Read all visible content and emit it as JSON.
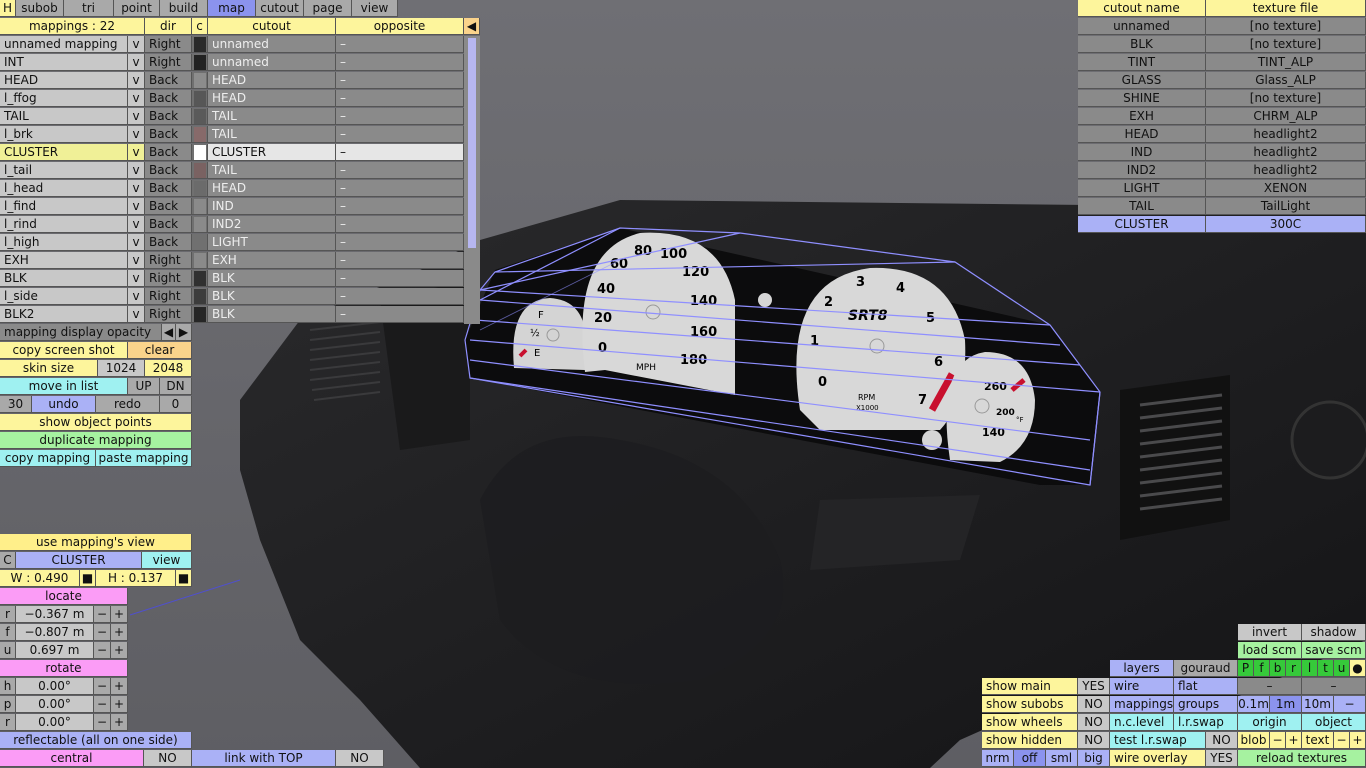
{
  "menu": {
    "h": "H",
    "items": [
      "subob",
      "tri",
      "point",
      "build",
      "map",
      "cutout",
      "page",
      "view"
    ],
    "active": "map"
  },
  "mappings": {
    "header": {
      "count": "mappings : 22",
      "dir": "dir",
      "c": "c",
      "cutout": "cutout",
      "opposite": "opposite",
      "arrow": "◀"
    },
    "rows": [
      {
        "name": "unnamed mapping",
        "v": "v",
        "dir": "Right",
        "swatch": "#2a2a2a",
        "cutout": "unnamed",
        "opposite": "–"
      },
      {
        "name": "INT",
        "v": "v",
        "dir": "Right",
        "swatch": "#222222",
        "cutout": "unnamed",
        "opposite": "–"
      },
      {
        "name": "HEAD",
        "v": "v",
        "dir": "Back",
        "swatch": "#8c8c8c",
        "cutout": "HEAD",
        "opposite": "–"
      },
      {
        "name": "l_ffog",
        "v": "v",
        "dir": "Back",
        "swatch": "#575757",
        "cutout": "HEAD",
        "opposite": "–"
      },
      {
        "name": "TAIL",
        "v": "v",
        "dir": "Back",
        "swatch": "#5a5a5a",
        "cutout": "TAIL",
        "opposite": "–"
      },
      {
        "name": "l_brk",
        "v": "v",
        "dir": "Back",
        "swatch": "#876a6a",
        "cutout": "TAIL",
        "opposite": "–"
      },
      {
        "name": "CLUSTER",
        "v": "v",
        "dir": "Back",
        "swatch": "#ffffff",
        "cutout": "CLUSTER",
        "opposite": "–",
        "selected": true
      },
      {
        "name": "l_tail",
        "v": "v",
        "dir": "Back",
        "swatch": "#7a6262",
        "cutout": "TAIL",
        "opposite": "–"
      },
      {
        "name": "l_head",
        "v": "v",
        "dir": "Back",
        "swatch": "#6b6b6b",
        "cutout": "HEAD",
        "opposite": "–"
      },
      {
        "name": "l_find",
        "v": "v",
        "dir": "Back",
        "swatch": "#8a8a8a",
        "cutout": "IND",
        "opposite": "–"
      },
      {
        "name": "l_rind",
        "v": "v",
        "dir": "Back",
        "swatch": "#8a8a8a",
        "cutout": "IND2",
        "opposite": "–"
      },
      {
        "name": "l_high",
        "v": "v",
        "dir": "Back",
        "swatch": "#707070",
        "cutout": "LIGHT",
        "opposite": "–"
      },
      {
        "name": "EXH",
        "v": "v",
        "dir": "Right",
        "swatch": "#8a8a8a",
        "cutout": "EXH",
        "opposite": "–"
      },
      {
        "name": "BLK",
        "v": "v",
        "dir": "Right",
        "swatch": "#303030",
        "cutout": "BLK",
        "opposite": "–"
      },
      {
        "name": "l_side",
        "v": "v",
        "dir": "Right",
        "swatch": "#3c3c3c",
        "cutout": "BLK",
        "opposite": "–"
      },
      {
        "name": "BLK2",
        "v": "v",
        "dir": "Right",
        "swatch": "#262626",
        "cutout": "BLK",
        "opposite": "–"
      }
    ]
  },
  "tools": {
    "opacity": "mapping display opacity",
    "left": "◀",
    "right": "▶",
    "copy_shot": "copy screen shot",
    "clear": "clear",
    "skin_size": "skin size",
    "s1024": "1024",
    "s2048": "2048",
    "move": "move in list",
    "up": "UP",
    "dn": "DN",
    "undo_count": "30",
    "undo": "undo",
    "redo": "redo",
    "redo_count": "0",
    "show_points": "show object points",
    "duplicate": "duplicate mapping",
    "copy_map": "copy mapping",
    "paste_map": "paste mapping"
  },
  "mapview": {
    "use_view": "use mapping's view",
    "c": "C",
    "name": "CLUSTER",
    "view": "view",
    "w": "W : 0.490",
    "h": "H : 0.137",
    "sq": "■",
    "locate": "locate",
    "loc": [
      {
        "axis": "r",
        "val": "−0.367 m"
      },
      {
        "axis": "f",
        "val": "−0.807 m"
      },
      {
        "axis": "u",
        "val": "0.697 m"
      }
    ],
    "rotate": "rotate",
    "rot": [
      {
        "axis": "h",
        "val": "0.00°"
      },
      {
        "axis": "p",
        "val": "0.00°"
      },
      {
        "axis": "r",
        "val": "0.00°"
      }
    ],
    "minus": "−",
    "plus": "+",
    "reflectable": "reflectable (all on one side)",
    "central": "central",
    "central_val": "NO",
    "link": "link with TOP",
    "link_val": "NO"
  },
  "cutouts": {
    "header": {
      "name": "cutout name",
      "tex": "texture file"
    },
    "rows": [
      {
        "name": "unnamed",
        "tex": "[no texture]"
      },
      {
        "name": "BLK",
        "tex": "[no texture]"
      },
      {
        "name": "TINT",
        "tex": "TINT_ALP"
      },
      {
        "name": "GLASS",
        "tex": "Glass_ALP"
      },
      {
        "name": "SHINE",
        "tex": "[no texture]"
      },
      {
        "name": "EXH",
        "tex": "CHRM_ALP"
      },
      {
        "name": "HEAD",
        "tex": "headlight2"
      },
      {
        "name": "IND",
        "tex": "headlight2"
      },
      {
        "name": "IND2",
        "tex": "headlight2"
      },
      {
        "name": "LIGHT",
        "tex": "XENON"
      },
      {
        "name": "TAIL",
        "tex": "TailLight"
      },
      {
        "name": "CLUSTER",
        "tex": "300C",
        "selected": true
      }
    ]
  },
  "bottomright": {
    "invert": "invert",
    "shadow": "shadow",
    "load": "load scm",
    "save": "save scm",
    "layers": "layers",
    "gouraud": "gouraud",
    "letters": [
      "P",
      "f",
      "b",
      "r",
      "l",
      "t",
      "u"
    ],
    "dot": "●",
    "wire": "wire",
    "flat": "flat",
    "dash": "–",
    "show_main": "show main",
    "show_main_v": "YES",
    "show_subobs": "show subobs",
    "show_subobs_v": "NO",
    "mappings": "mappings",
    "groups": "groups",
    "g01": "0.1m",
    "g1": "1m",
    "g10": "10m",
    "gm": "−",
    "show_wheels": "show wheels",
    "show_wheels_v": "NO",
    "nclevel": "n.c.level",
    "lrswap": "l.r.swap",
    "origin": "origin",
    "object": "object",
    "show_hidden": "show hidden",
    "show_hidden_v": "NO",
    "test_lr": "test l.r.swap",
    "test_lr_v": "NO",
    "blob": "blob",
    "text": "text",
    "minus": "−",
    "plus": "+",
    "nrm": "nrm",
    "off": "off",
    "sml": "sml",
    "big": "big",
    "wire_overlay": "wire overlay",
    "wire_overlay_v": "YES",
    "reload": "reload textures"
  },
  "gauges": {
    "left_small": [
      "F",
      "½",
      "E"
    ],
    "speedo": [
      "0",
      "20",
      "40",
      "60",
      "80",
      "100",
      "120",
      "140",
      "160",
      "180"
    ],
    "speedo_unit": "MPH",
    "tach": [
      "0",
      "1",
      "2",
      "3",
      "4",
      "5",
      "6",
      "7"
    ],
    "tach_brand": "SRT8",
    "tach_unit": "RPM",
    "tach_mult": "X1000",
    "temp": [
      "140",
      "200",
      "260"
    ],
    "temp_unit": "°F"
  },
  "colors": {
    "bg": "#6e6e72",
    "wire": "#8f8fff",
    "accent_red": "#c8102e"
  }
}
